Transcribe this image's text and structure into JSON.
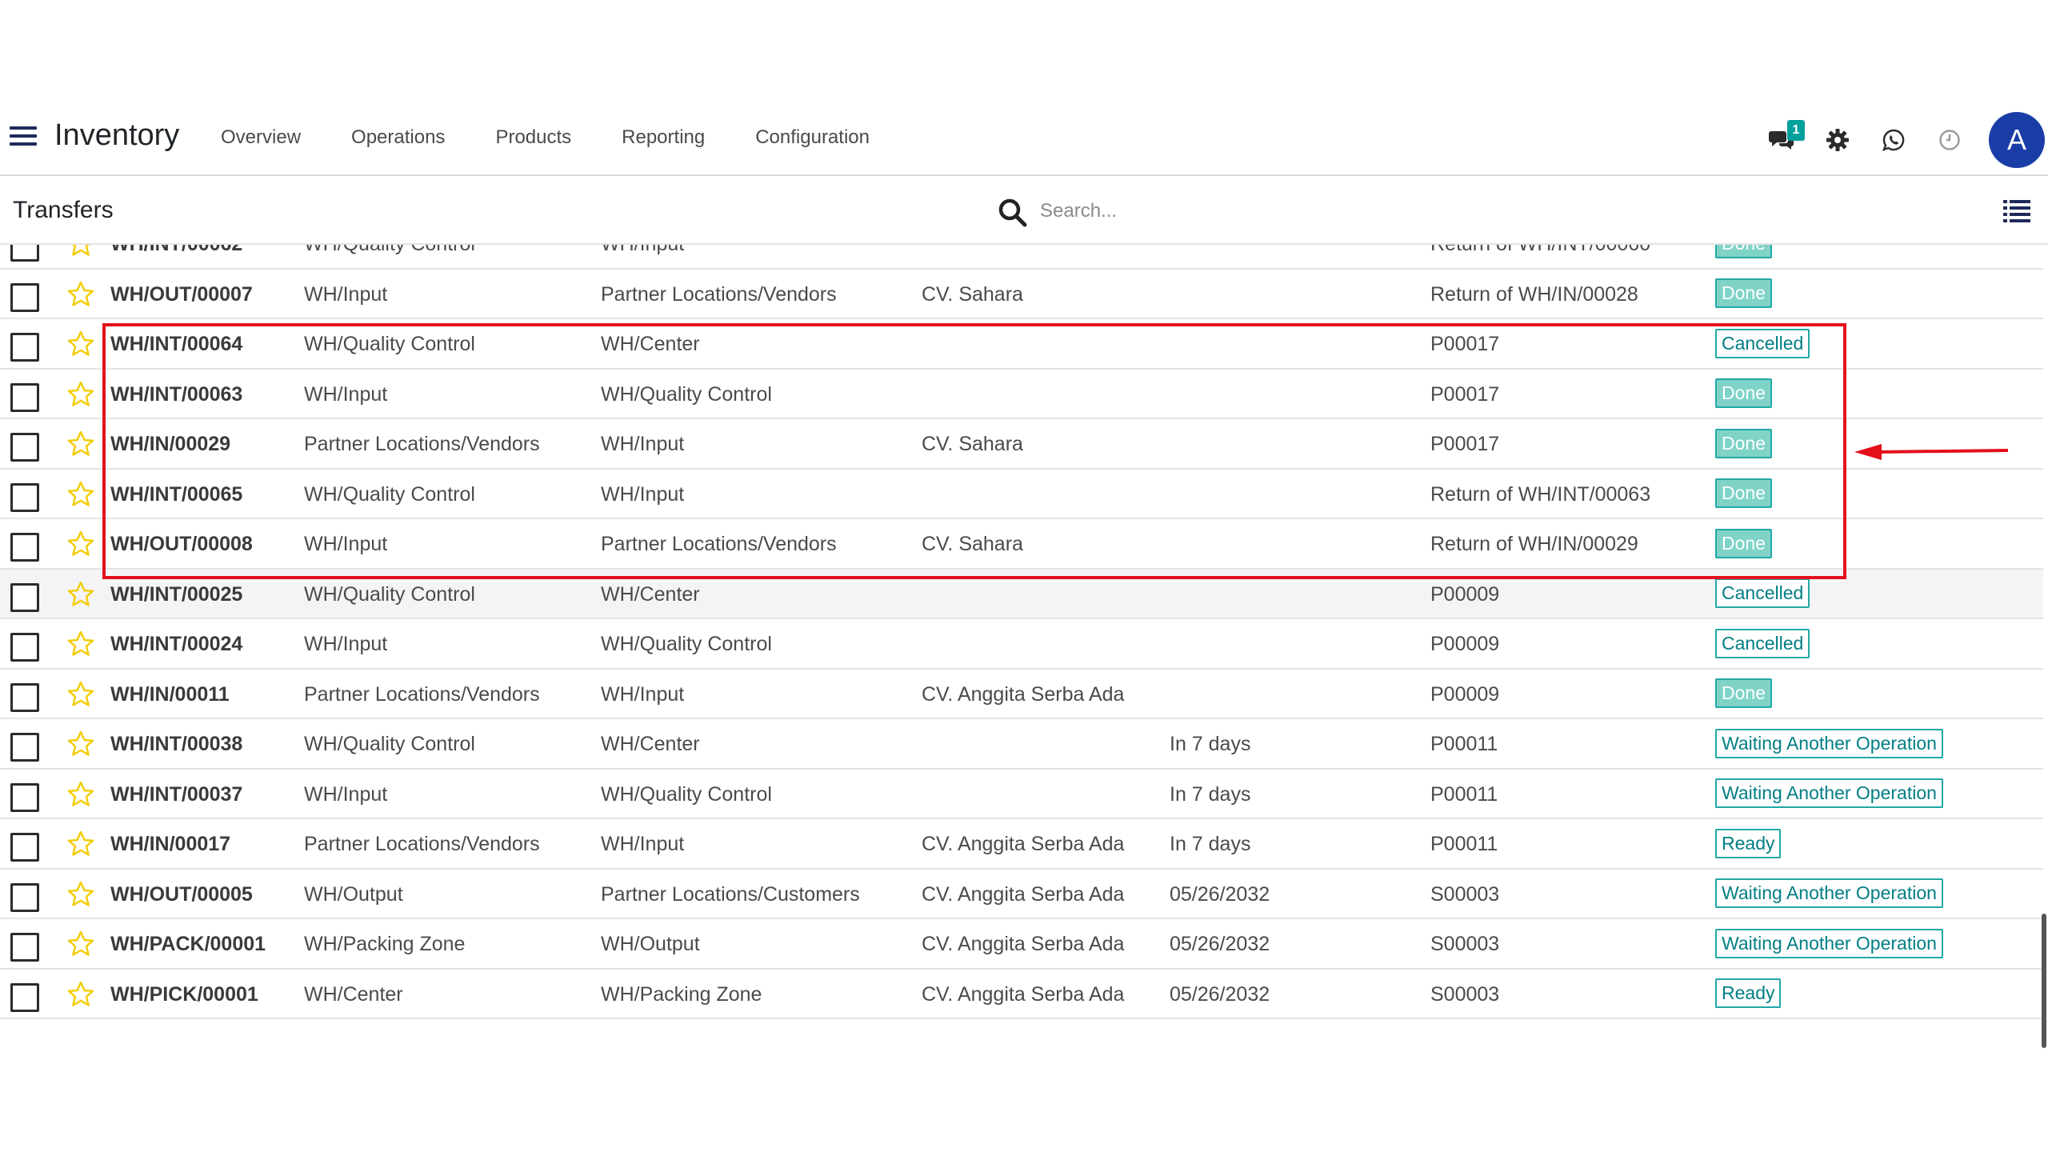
{
  "app": {
    "title": "Inventory",
    "nav": [
      "Overview",
      "Operations",
      "Products",
      "Reporting",
      "Configuration"
    ],
    "message_count": "1",
    "avatar_initial": "A",
    "icons": [
      "hamburger-menu-icon",
      "chat-icon",
      "gear-icon",
      "whatsapp-icon",
      "clock-icon"
    ]
  },
  "control": {
    "breadcrumb": "Transfers",
    "search_placeholder": "Search..."
  },
  "colors": {
    "highlight": "#e3101b",
    "accent": "#00a09d",
    "avatar": "#1a3ca6",
    "star": "#f3cc00"
  },
  "rows": [
    {
      "ref": "WH/INT/00062",
      "from": "WH/Quality Control",
      "to": "WH/Input",
      "contact": "",
      "scheduled": "",
      "source": "Return of WH/INT/00060",
      "status": "Done"
    },
    {
      "ref": "WH/OUT/00007",
      "from": "WH/Input",
      "to": "Partner Locations/Vendors",
      "contact": "CV. Sahara",
      "scheduled": "",
      "source": "Return of WH/IN/00028",
      "status": "Done"
    },
    {
      "ref": "WH/INT/00064",
      "from": "WH/Quality Control",
      "to": "WH/Center",
      "contact": "",
      "scheduled": "",
      "source": "P00017",
      "status": "Cancelled"
    },
    {
      "ref": "WH/INT/00063",
      "from": "WH/Input",
      "to": "WH/Quality Control",
      "contact": "",
      "scheduled": "",
      "source": "P00017",
      "status": "Done"
    },
    {
      "ref": "WH/IN/00029",
      "from": "Partner Locations/Vendors",
      "to": "WH/Input",
      "contact": "CV. Sahara",
      "scheduled": "",
      "source": "P00017",
      "status": "Done"
    },
    {
      "ref": "WH/INT/00065",
      "from": "WH/Quality Control",
      "to": "WH/Input",
      "contact": "",
      "scheduled": "",
      "source": "Return of WH/INT/00063",
      "status": "Done"
    },
    {
      "ref": "WH/OUT/00008",
      "from": "WH/Input",
      "to": "Partner Locations/Vendors",
      "contact": "CV. Sahara",
      "scheduled": "",
      "source": "Return of WH/IN/00029",
      "status": "Done"
    },
    {
      "ref": "WH/INT/00025",
      "from": "WH/Quality Control",
      "to": "WH/Center",
      "contact": "",
      "scheduled": "",
      "source": "P00009",
      "status": "Cancelled"
    },
    {
      "ref": "WH/INT/00024",
      "from": "WH/Input",
      "to": "WH/Quality Control",
      "contact": "",
      "scheduled": "",
      "source": "P00009",
      "status": "Cancelled"
    },
    {
      "ref": "WH/IN/00011",
      "from": "Partner Locations/Vendors",
      "to": "WH/Input",
      "contact": "CV. Anggita Serba Ada",
      "scheduled": "",
      "source": "P00009",
      "status": "Done"
    },
    {
      "ref": "WH/INT/00038",
      "from": "WH/Quality Control",
      "to": "WH/Center",
      "contact": "",
      "scheduled": "In 7 days",
      "source": "P00011",
      "status": "Waiting Another Operation"
    },
    {
      "ref": "WH/INT/00037",
      "from": "WH/Input",
      "to": "WH/Quality Control",
      "contact": "",
      "scheduled": "In 7 days",
      "source": "P00011",
      "status": "Waiting Another Operation"
    },
    {
      "ref": "WH/IN/00017",
      "from": "Partner Locations/Vendors",
      "to": "WH/Input",
      "contact": "CV. Anggita Serba Ada",
      "scheduled": "In 7 days",
      "source": "P00011",
      "status": "Ready"
    },
    {
      "ref": "WH/OUT/00005",
      "from": "WH/Output",
      "to": "Partner Locations/Customers",
      "contact": "CV. Anggita Serba Ada",
      "scheduled": "05/26/2032",
      "source": "S00003",
      "status": "Waiting Another Operation"
    },
    {
      "ref": "WH/PACK/00001",
      "from": "WH/Packing Zone",
      "to": "WH/Output",
      "contact": "CV. Anggita Serba Ada",
      "scheduled": "05/26/2032",
      "source": "S00003",
      "status": "Waiting Another Operation"
    },
    {
      "ref": "WH/PICK/00001",
      "from": "WH/Center",
      "to": "WH/Packing Zone",
      "contact": "CV. Anggita Serba Ada",
      "scheduled": "05/26/2032",
      "source": "S00003",
      "status": "Ready"
    }
  ]
}
